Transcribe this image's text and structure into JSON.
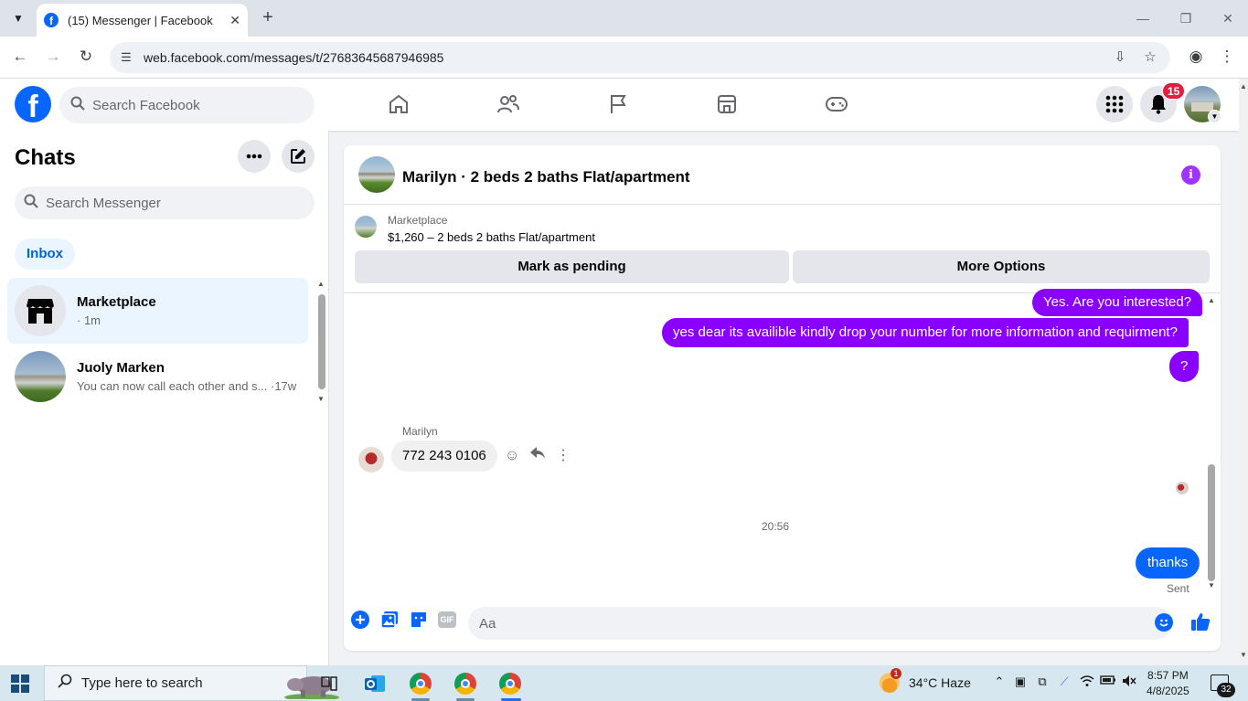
{
  "browser": {
    "tab_title": "(15) Messenger | Facebook",
    "url": "web.facebook.com/messages/t/27683645687946985"
  },
  "fb": {
    "search_placeholder": "Search Facebook",
    "notification_count": "15"
  },
  "sidebar": {
    "title": "Chats",
    "search_placeholder": "Search Messenger",
    "filter": "Inbox",
    "conversations": [
      {
        "name": "Marketplace",
        "meta": "· 1m"
      },
      {
        "name": "Juoly Marken",
        "meta": "You can now call each other and s... ·17w"
      }
    ]
  },
  "conversation": {
    "title": "Marilyn · 2 beds 2 baths Flat/apartment",
    "marketplace_label": "Marketplace",
    "listing": "$1,260 – 2 beds 2 baths Flat/apartment",
    "mark_pending": "Mark as pending",
    "more_options": "More Options",
    "messages": [
      {
        "from": "me",
        "text": "Yes. Are you interested?"
      },
      {
        "from": "me",
        "text": "yes dear  its availible kindly drop your number for more information and requirment?"
      },
      {
        "from": "me",
        "text": "?"
      },
      {
        "from": "Marilyn",
        "text": "772 243 0106"
      },
      {
        "from": "me",
        "text": "thanks"
      }
    ],
    "sender_name": "Marilyn",
    "timestamp": "20:56",
    "sent_status": "Sent",
    "composer_placeholder": "Aa"
  },
  "taskbar": {
    "search_placeholder": "Type here to search",
    "weather_badge": "1",
    "weather": "34°C  Haze",
    "time": "8:57 PM",
    "date": "4/8/2025",
    "notifications": "32"
  },
  "colors": {
    "fb_blue": "#0866ff",
    "purple_bubble": "#8a00ff",
    "badge_red": "#e41e3f"
  }
}
